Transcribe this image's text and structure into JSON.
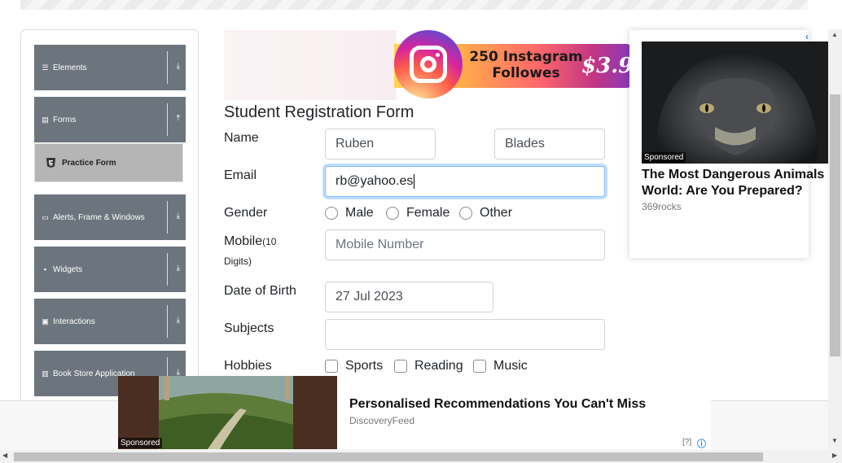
{
  "sidebar": {
    "groups": [
      {
        "label": "Elements",
        "icon": "menu-icon",
        "arrow": "⤓"
      },
      {
        "label": "Forms",
        "icon": "document-icon",
        "arrow": "⤒"
      },
      {
        "label": "Alerts, Frame & Windows",
        "icon": "window-icon",
        "arrow": "⤓"
      },
      {
        "label": "Widgets",
        "icon": "grid-icon",
        "arrow": "⤓"
      },
      {
        "label": "Interactions",
        "icon": "list-icon",
        "arrow": "⤓"
      },
      {
        "label": "Book Store Application",
        "icon": "library-icon",
        "arrow": "⤓"
      }
    ],
    "active_item": "Practice Form"
  },
  "top_ad": {
    "text": "250 Instagram Followes",
    "price": "$3.9"
  },
  "form": {
    "title": "Student Registration Form",
    "name_label": "Name",
    "first_name": "Ruben",
    "last_name": "Blades",
    "email_label": "Email",
    "email": "rb@yahoo.es",
    "gender_label": "Gender",
    "genders": [
      "Male",
      "Female",
      "Other"
    ],
    "mobile_label": "Mobile",
    "mobile_hint": "(10 Digits)",
    "mobile_placeholder": "Mobile Number",
    "dob_label": "Date of Birth",
    "dob": "27 Jul 2023",
    "subjects_label": "Subjects",
    "subjects_value": "",
    "hobbies_label": "Hobbies",
    "hobbies": [
      "Sports",
      "Reading",
      "Music"
    ]
  },
  "right_ad": {
    "sponsored": "Sponsored",
    "headline": "The Most Dangerous Animals World: Are You Prepared?",
    "source": "369rocks"
  },
  "bottom_ad": {
    "sponsored": "Sponsored",
    "headline": "Personalised Recommendations You Can't Miss",
    "source": "DiscoveryFeed",
    "info": "[?]"
  },
  "colors": {
    "sidebar_group": "#6c757d",
    "active_item": "#b5b5b5",
    "focus_border": "#80bdff"
  }
}
